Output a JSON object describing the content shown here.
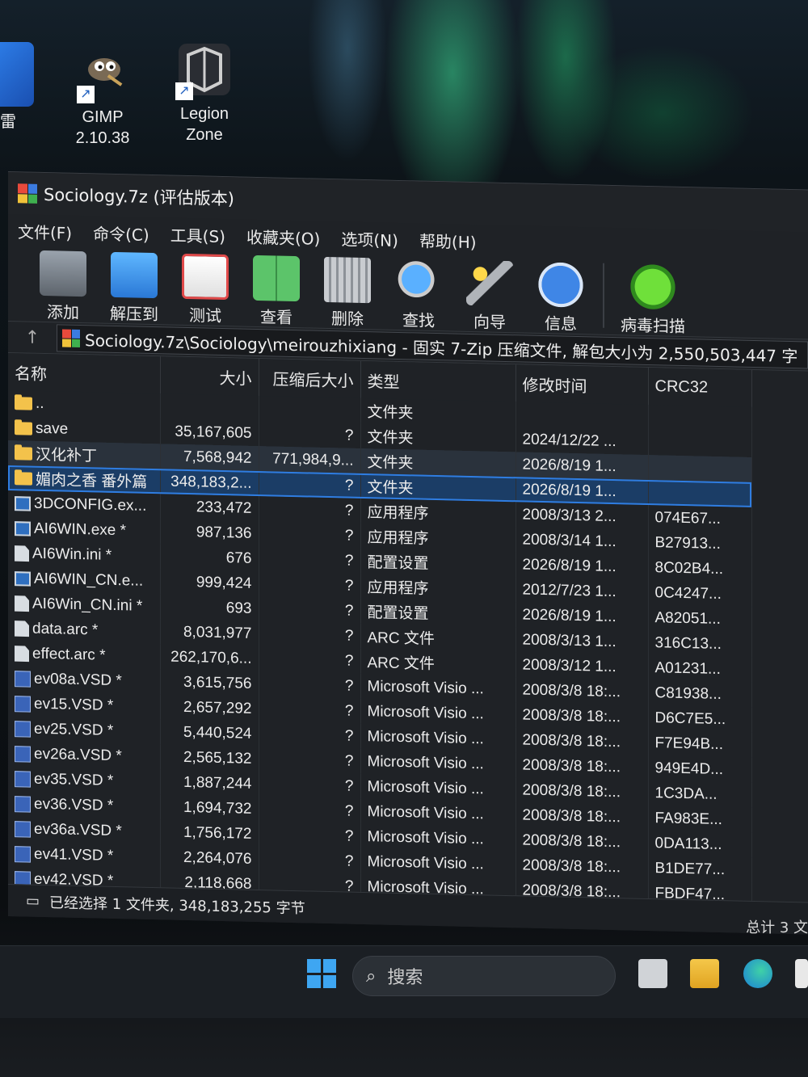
{
  "desktop": {
    "icons": [
      {
        "label1": "GIMP",
        "label2": "2.10.38"
      },
      {
        "label1": "Legion",
        "label2": "Zone"
      }
    ],
    "partial_label": "雷"
  },
  "window": {
    "title": "Sociology.7z (评估版本)",
    "menu": [
      "文件(F)",
      "命令(C)",
      "工具(S)",
      "收藏夹(O)",
      "选项(N)",
      "帮助(H)"
    ],
    "toolbar": [
      {
        "label": "添加",
        "icon": "add-icon"
      },
      {
        "label": "解压到",
        "icon": "extract-icon"
      },
      {
        "label": "测试",
        "icon": "test-icon"
      },
      {
        "label": "查看",
        "icon": "view-icon"
      },
      {
        "label": "删除",
        "icon": "delete-icon"
      },
      {
        "label": "查找",
        "icon": "find-icon"
      },
      {
        "label": "向导",
        "icon": "wizard-icon"
      },
      {
        "label": "信息",
        "icon": "info-icon"
      },
      {
        "label": "病毒扫描",
        "icon": "virus-scan-icon"
      }
    ],
    "address": "Sociology.7z\\Sociology\\meirouzhixiang - 固实 7-Zip 压缩文件, 解包大小为 2,550,503,447 字",
    "columns": {
      "name": "名称",
      "size": "大小",
      "packed": "压缩后大小",
      "type": "类型",
      "modified": "修改时间",
      "crc": "CRC32"
    },
    "rows": [
      {
        "icon": "folder",
        "name": "..",
        "size": "",
        "packed": "",
        "type": "文件夹",
        "modified": "",
        "crc": ""
      },
      {
        "icon": "folder",
        "name": "save",
        "size": "35,167,605",
        "packed": "?",
        "type": "文件夹",
        "modified": "2024/12/22 ...",
        "crc": ""
      },
      {
        "icon": "folder",
        "name": "汉化补丁",
        "size": "7,568,942",
        "packed": "771,984,9...",
        "type": "文件夹",
        "modified": "2026/8/19 1...",
        "crc": "",
        "state": "hover"
      },
      {
        "icon": "folder",
        "name": "媚肉之香 番外篇",
        "size": "348,183,2...",
        "packed": "?",
        "type": "文件夹",
        "modified": "2026/8/19 1...",
        "crc": "",
        "state": "selected"
      },
      {
        "icon": "exe",
        "name": "3DCONFIG.ex...",
        "size": "233,472",
        "packed": "?",
        "type": "应用程序",
        "modified": "2008/3/13 2...",
        "crc": "074E67..."
      },
      {
        "icon": "exe",
        "name": "AI6WIN.exe *",
        "size": "987,136",
        "packed": "?",
        "type": "应用程序",
        "modified": "2008/3/14 1...",
        "crc": "B27913..."
      },
      {
        "icon": "ini",
        "name": "AI6Win.ini *",
        "size": "676",
        "packed": "?",
        "type": "配置设置",
        "modified": "2026/8/19 1...",
        "crc": "8C02B4..."
      },
      {
        "icon": "exe",
        "name": "AI6WIN_CN.e...",
        "size": "999,424",
        "packed": "?",
        "type": "应用程序",
        "modified": "2012/7/23 1...",
        "crc": "0C4247..."
      },
      {
        "icon": "ini",
        "name": "AI6Win_CN.ini *",
        "size": "693",
        "packed": "?",
        "type": "配置设置",
        "modified": "2026/8/19 1...",
        "crc": "A82051..."
      },
      {
        "icon": "ini",
        "name": "data.arc *",
        "size": "8,031,977",
        "packed": "?",
        "type": "ARC 文件",
        "modified": "2008/3/13 1...",
        "crc": "316C13..."
      },
      {
        "icon": "ini",
        "name": "effect.arc *",
        "size": "262,170,6...",
        "packed": "?",
        "type": "ARC 文件",
        "modified": "2008/3/12 1...",
        "crc": "A01231..."
      },
      {
        "icon": "vsd",
        "name": "ev08a.VSD *",
        "size": "3,615,756",
        "packed": "?",
        "type": "Microsoft Visio ...",
        "modified": "2008/3/8 18:...",
        "crc": "C81938..."
      },
      {
        "icon": "vsd",
        "name": "ev15.VSD *",
        "size": "2,657,292",
        "packed": "?",
        "type": "Microsoft Visio ...",
        "modified": "2008/3/8 18:...",
        "crc": "D6C7E5..."
      },
      {
        "icon": "vsd",
        "name": "ev25.VSD *",
        "size": "5,440,524",
        "packed": "?",
        "type": "Microsoft Visio ...",
        "modified": "2008/3/8 18:...",
        "crc": "F7E94B..."
      },
      {
        "icon": "vsd",
        "name": "ev26a.VSD *",
        "size": "2,565,132",
        "packed": "?",
        "type": "Microsoft Visio ...",
        "modified": "2008/3/8 18:...",
        "crc": "949E4D..."
      },
      {
        "icon": "vsd",
        "name": "ev35.VSD *",
        "size": "1,887,244",
        "packed": "?",
        "type": "Microsoft Visio ...",
        "modified": "2008/3/8 18:...",
        "crc": "1C3DA..."
      },
      {
        "icon": "vsd",
        "name": "ev36.VSD *",
        "size": "1,694,732",
        "packed": "?",
        "type": "Microsoft Visio ...",
        "modified": "2008/3/8 18:...",
        "crc": "FA983E..."
      },
      {
        "icon": "vsd",
        "name": "ev36a.VSD *",
        "size": "1,756,172",
        "packed": "?",
        "type": "Microsoft Visio ...",
        "modified": "2008/3/8 18:...",
        "crc": "0DA113..."
      },
      {
        "icon": "vsd",
        "name": "ev41.VSD *",
        "size": "2,264,076",
        "packed": "?",
        "type": "Microsoft Visio ...",
        "modified": "2008/3/8 18:...",
        "crc": "B1DE77..."
      },
      {
        "icon": "vsd",
        "name": "ev42.VSD *",
        "size": "2,118,668",
        "packed": "?",
        "type": "Microsoft Visio ...",
        "modified": "2008/3/8 18:...",
        "crc": "FBDF47..."
      }
    ],
    "status": "已经选择 1 文件夹, 348,183,255 字节",
    "total": "总计 3 文"
  },
  "taskbar": {
    "search_placeholder": "搜索"
  },
  "colors": {
    "accent": "#2f7de1",
    "folder": "#f3c24b",
    "selected_row": "#1b3d66"
  }
}
